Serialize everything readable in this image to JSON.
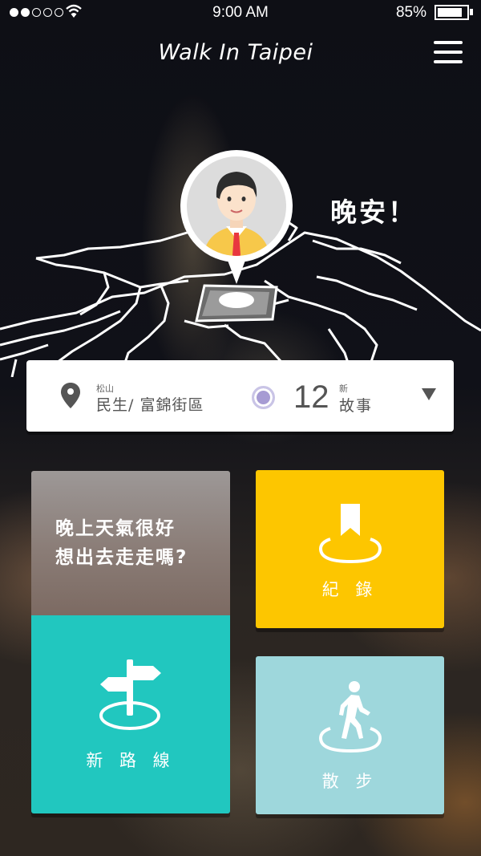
{
  "status_bar": {
    "time": "9:00  AM",
    "battery_percent": "85%",
    "battery_level": 0.85,
    "signal_bars_filled": 2,
    "signal_bars_total": 5
  },
  "header": {
    "title": "Walk In Taipei",
    "menu_icon": "hamburger-menu-icon"
  },
  "profile": {
    "avatar_icon": "user-avatar-icon",
    "greeting": "晚安！"
  },
  "location": {
    "pin_icon": "location-pin-icon",
    "district": "松山",
    "area": "民生/ 富錦街區",
    "story_count": "12",
    "story_new_label": "新",
    "story_label": "故事",
    "dropdown_icon": "caret-down-icon"
  },
  "tiles": {
    "weather_line1": "晚上天氣很好",
    "weather_line2": "想出去走走嗎?",
    "route_label": "新 路 線",
    "route_icon": "signpost-icon",
    "record_label": "紀 錄",
    "record_icon": "bookmark-icon",
    "walk_label": "散 步",
    "walk_icon": "walking-person-icon"
  },
  "colors": {
    "route_tile": "#21c7bf",
    "record_tile": "#fdc600",
    "walk_tile": "#9ed7dc",
    "story_dot": "#a69bd3",
    "avatar_shirt": "#f7c84a",
    "avatar_tie": "#e8373f"
  }
}
